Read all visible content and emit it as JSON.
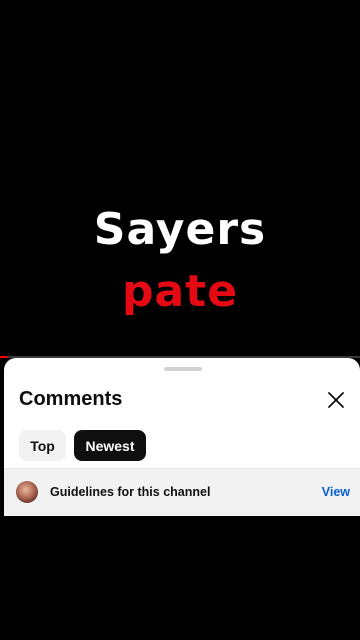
{
  "video": {
    "line1": "Sayers",
    "line2": "pate",
    "line2_color": "#e50914",
    "progress_fraction": 0.02
  },
  "comments_sheet": {
    "title": "Comments",
    "close_icon": "close-icon",
    "filters": [
      {
        "label": "Top",
        "selected": false
      },
      {
        "label": "Newest",
        "selected": true
      }
    ],
    "guidelines": {
      "text": "Guidelines for this channel",
      "action_label": "View",
      "action_color": "#065fd4"
    }
  }
}
